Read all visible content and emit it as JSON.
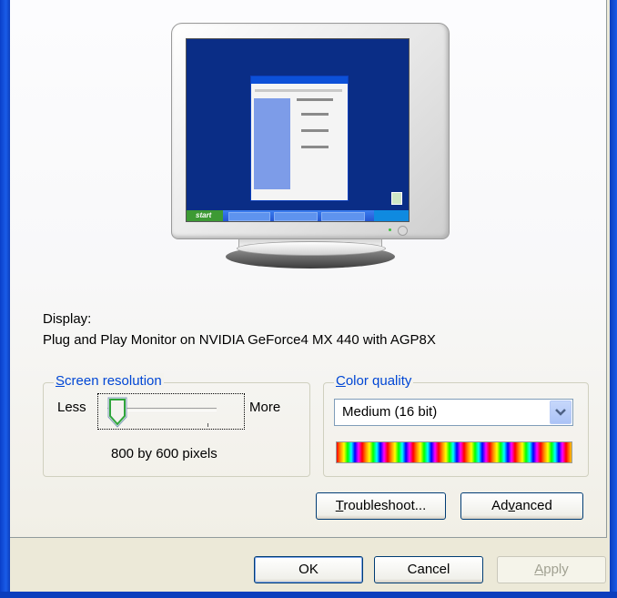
{
  "display": {
    "label": "Display:",
    "device": "Plug and Play Monitor on NVIDIA GeForce4 MX 440 with AGP8X"
  },
  "screen_resolution": {
    "title_hotkey": "S",
    "title_rest": "creen resolution",
    "less_label": "Less",
    "more_label": "More",
    "value_text": "800 by 600 pixels",
    "slider_position": 0
  },
  "color_quality": {
    "title_hotkey": "C",
    "title_rest": "olor quality",
    "selected": "Medium (16 bit)"
  },
  "buttons": {
    "troubleshoot_hotkey": "T",
    "troubleshoot_rest": "roubleshoot...",
    "advanced_pre": "Ad",
    "advanced_hotkey": "v",
    "advanced_rest": "anced",
    "ok": "OK",
    "cancel": "Cancel",
    "apply_hotkey": "A",
    "apply_rest": "pply"
  },
  "preview": {
    "start_label": "start"
  },
  "colors": {
    "frame_blue": "#0b3ebd",
    "group_title": "#0046d5",
    "dialog_bg": "#ece9d8"
  }
}
